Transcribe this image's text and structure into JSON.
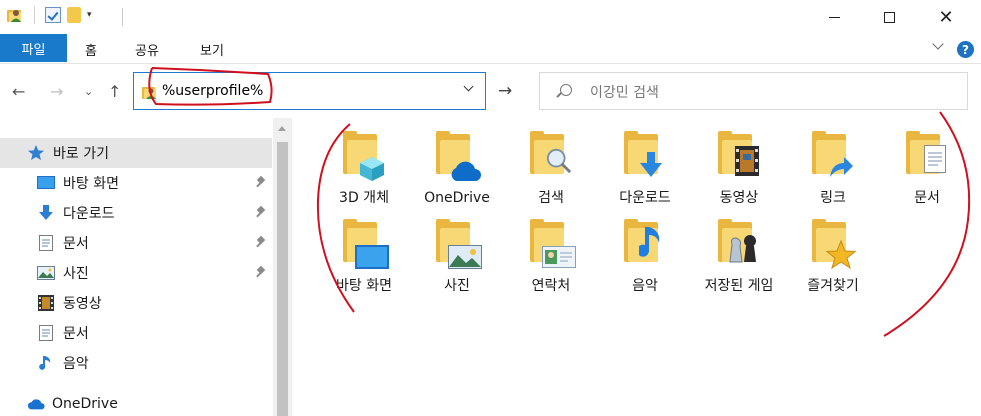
{
  "ribbon": {
    "file_tab": "파일",
    "tabs": [
      "홈",
      "공유",
      "보기"
    ],
    "help_label": "?"
  },
  "address": {
    "path": "%userprofile%"
  },
  "search": {
    "placeholder": "이강민 검색"
  },
  "sidebar": {
    "items": [
      {
        "label": "바로 가기",
        "icon": "star-icon"
      },
      {
        "label": "바탕 화면",
        "icon": "desktop-icon",
        "pinned": true
      },
      {
        "label": "다운로드",
        "icon": "download-icon",
        "pinned": true
      },
      {
        "label": "문서",
        "icon": "document-icon",
        "pinned": true
      },
      {
        "label": "사진",
        "icon": "picture-icon",
        "pinned": true
      },
      {
        "label": "동영상",
        "icon": "video-icon"
      },
      {
        "label": "문서",
        "icon": "document-icon"
      },
      {
        "label": "음악",
        "icon": "music-icon"
      },
      {
        "label": "OneDrive",
        "icon": "cloud-icon"
      }
    ]
  },
  "folders": [
    {
      "label": "3D 개체",
      "icon": "cube-icon"
    },
    {
      "label": "OneDrive",
      "icon": "cloud-icon"
    },
    {
      "label": "검색",
      "icon": "magnifier-icon"
    },
    {
      "label": "다운로드",
      "icon": "download-icon"
    },
    {
      "label": "동영상",
      "icon": "film-icon"
    },
    {
      "label": "링크",
      "icon": "link-arrow-icon"
    },
    {
      "label": "문서",
      "icon": "document-icon"
    },
    {
      "label": "바탕 화면",
      "icon": "desktop-icon"
    },
    {
      "label": "사진",
      "icon": "picture-icon"
    },
    {
      "label": "연락처",
      "icon": "contact-card-icon"
    },
    {
      "label": "음악",
      "icon": "music-note-icon"
    },
    {
      "label": "저장된 게임",
      "icon": "chess-icon"
    },
    {
      "label": "즐겨찾기",
      "icon": "star-icon"
    }
  ],
  "colors": {
    "accent": "#1979ca",
    "annotation": "#d0101e",
    "folder": "#f8d775"
  }
}
